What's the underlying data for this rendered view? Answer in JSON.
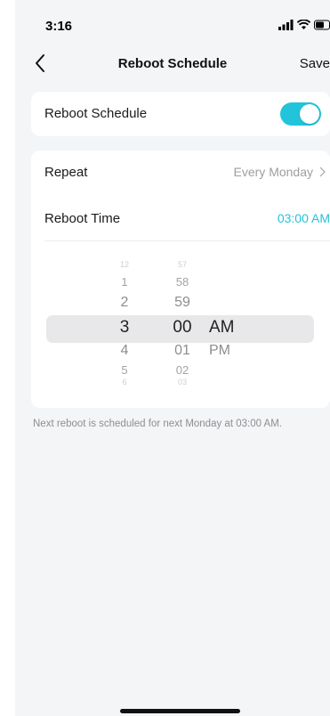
{
  "status_bar": {
    "time": "3:16",
    "icons": [
      "signal-icon",
      "wifi-icon",
      "battery-icon"
    ]
  },
  "nav": {
    "back_icon": "chevron-left-icon",
    "title": "Reboot Schedule",
    "save_label": "Save"
  },
  "schedule_card": {
    "label": "Reboot Schedule",
    "toggle_on": true,
    "toggle_color": "#21c4d9"
  },
  "settings_card": {
    "repeat_label": "Repeat",
    "repeat_value": "Every Monday",
    "reboot_time_label": "Reboot Time",
    "reboot_time_value": "03:00 AM",
    "accent_color": "#25c2d8"
  },
  "picker": {
    "hours": [
      "12",
      "1",
      "2",
      "3",
      "4",
      "5",
      "6"
    ],
    "minutes": [
      "57",
      "58",
      "59",
      "00",
      "01",
      "02",
      "03"
    ],
    "ampm": [
      "AM",
      "PM"
    ],
    "selected": {
      "hour": "3",
      "minute": "00",
      "period": "AM"
    }
  },
  "note": "Next reboot is scheduled for next Monday at 03:00 AM."
}
